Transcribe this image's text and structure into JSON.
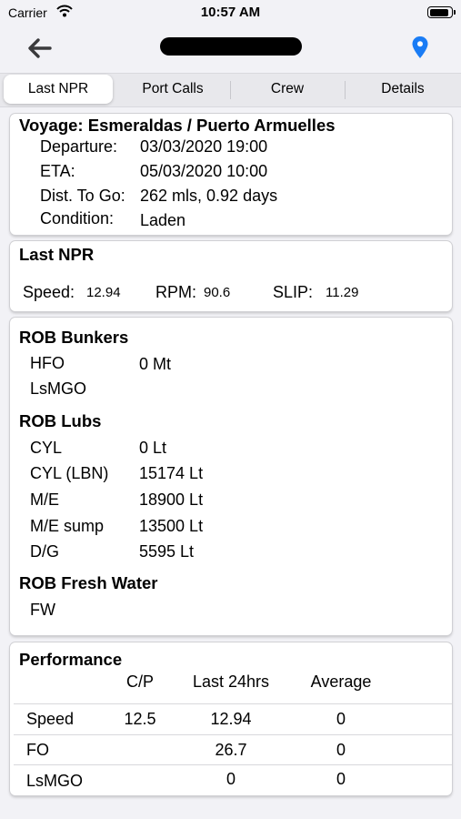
{
  "status_bar": {
    "carrier": "Carrier",
    "time": "10:57 AM"
  },
  "tabs": [
    "Last NPR",
    "Port Calls",
    "Crew",
    "Details"
  ],
  "voyage": {
    "title": "Voyage: Esmeraldas / Puerto Armuelles",
    "rows": [
      {
        "label": "Departure:",
        "value": "03/03/2020 19:00"
      },
      {
        "label": "ETA:",
        "value": "05/03/2020 10:00"
      },
      {
        "label": "Dist. To Go:",
        "value": "262 mls, 0.92 days"
      },
      {
        "label": "Condition:",
        "value": "Laden"
      }
    ]
  },
  "last_npr": {
    "title": "Last NPR",
    "speed_label": "Speed:",
    "speed_value": "12.94",
    "rpm_label": "RPM:",
    "rpm_value": "90.6",
    "slip_label": "SLIP:",
    "slip_value": "11.29"
  },
  "rob": {
    "bunkers_title": "ROB Bunkers",
    "bunkers": [
      {
        "label": "HFO",
        "value": "0 Mt"
      },
      {
        "label": "LsMGO",
        "value": ""
      }
    ],
    "lubs_title": "ROB Lubs",
    "lubs": [
      {
        "label": "CYL",
        "value": "0 Lt"
      },
      {
        "label": "CYL (LBN)",
        "value": "15174 Lt"
      },
      {
        "label": "M/E",
        "value": "18900 Lt"
      },
      {
        "label": "M/E sump",
        "value": "13500 Lt"
      },
      {
        "label": "D/G",
        "value": "5595 Lt"
      }
    ],
    "water_title": "ROB Fresh Water",
    "water": [
      {
        "label": "FW",
        "value": ""
      }
    ]
  },
  "performance": {
    "title": "Performance",
    "columns": [
      "C/P",
      "Last 24hrs",
      "Average"
    ],
    "rows": [
      {
        "label": "Speed",
        "cp": "12.5",
        "last24": "12.94",
        "avg": "0"
      },
      {
        "label": "FO",
        "cp": "",
        "last24": "26.7",
        "avg": "0"
      },
      {
        "label": "LsMGO",
        "cp": "",
        "last24": "0",
        "avg": "0"
      }
    ]
  },
  "battery_level": 0.95,
  "colors": {
    "accent": "#1a7cf5",
    "background": "#f2f2f6"
  }
}
